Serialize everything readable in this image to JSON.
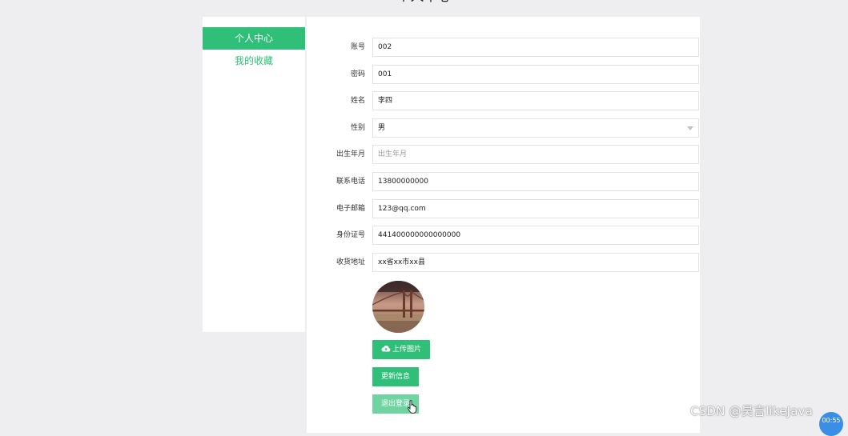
{
  "page": {
    "title": "个人中心"
  },
  "sidebar": {
    "items": [
      {
        "label": "个人中心",
        "active": true
      },
      {
        "label": "我的收藏",
        "active": false
      }
    ]
  },
  "form": {
    "account": {
      "label": "账号",
      "value": "002"
    },
    "password": {
      "label": "密码",
      "value": "001"
    },
    "name": {
      "label": "姓名",
      "value": "李四"
    },
    "gender": {
      "label": "性别",
      "value": "男"
    },
    "birth": {
      "label": "出生年月",
      "value": "",
      "placeholder": "出生年月"
    },
    "phone": {
      "label": "联系电话",
      "value": "13800000000"
    },
    "email": {
      "label": "电子邮箱",
      "value": "123@qq.com"
    },
    "idcard": {
      "label": "身份证号",
      "value": "441400000000000000"
    },
    "address": {
      "label": "收货地址",
      "value": "xx省xx市xx县"
    }
  },
  "buttons": {
    "upload": "上传图片",
    "update": "更新信息",
    "logout": "退出登录"
  },
  "overlay": {
    "watermark": "CSDN @昊言likeJava",
    "timer": "00:55"
  },
  "colors": {
    "accent": "#2fbf78",
    "accent_faded": "#6fd3a2",
    "background": "#eeeef0"
  },
  "icons": [
    "cloud-upload-icon",
    "chevron-down-icon",
    "hand-cursor-icon"
  ]
}
